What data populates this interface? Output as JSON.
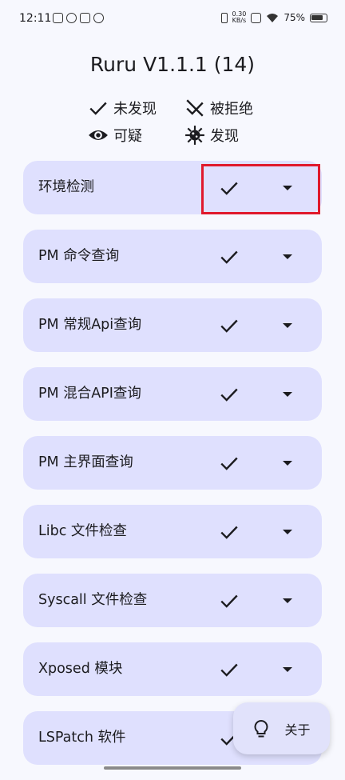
{
  "status_bar": {
    "time": "12:11",
    "net_speed_value": "0.30",
    "net_speed_unit": "KB/s",
    "battery": "75%"
  },
  "app": {
    "title": "Ruru V1.1.1 (14)"
  },
  "legend": {
    "not_found": "未发现",
    "denied": "被拒绝",
    "suspicious": "可疑",
    "found": "发现"
  },
  "checks": [
    {
      "label": "环境检测",
      "status": "not_found"
    },
    {
      "label": "PM 命令查询",
      "status": "not_found"
    },
    {
      "label": "PM 常规Api查询",
      "status": "not_found"
    },
    {
      "label": "PM 混合API查询",
      "status": "not_found"
    },
    {
      "label": "PM 主界面查询",
      "status": "not_found"
    },
    {
      "label": "Libc 文件检查",
      "status": "not_found"
    },
    {
      "label": "Syscall 文件检查",
      "status": "not_found"
    },
    {
      "label": "Xposed 模块",
      "status": "not_found"
    },
    {
      "label": "LSPatch 软件",
      "status": "not_found"
    }
  ],
  "fab": {
    "label": "关于"
  }
}
